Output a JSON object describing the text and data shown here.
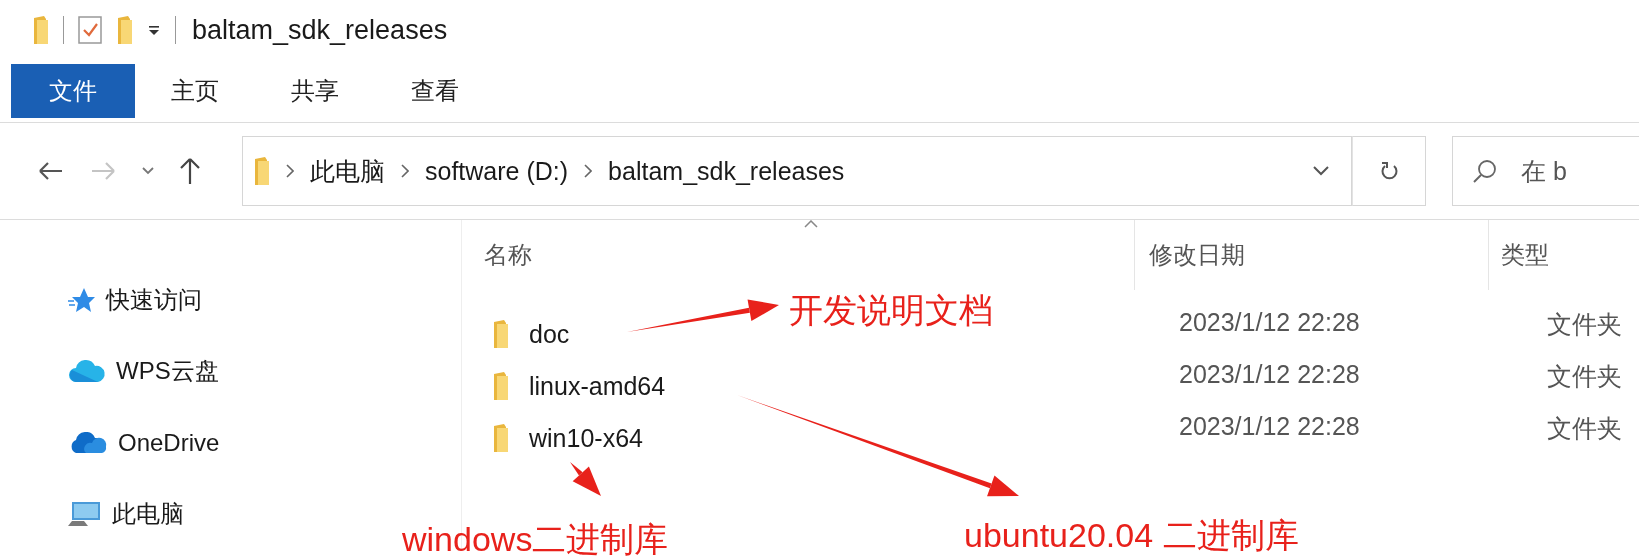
{
  "title_bar": {
    "title": "baltam_sdk_releases"
  },
  "ribbon": {
    "tabs": [
      {
        "label": "文件",
        "selected": true
      },
      {
        "label": "主页",
        "selected": false
      },
      {
        "label": "共享",
        "selected": false
      },
      {
        "label": "查看",
        "selected": false
      }
    ]
  },
  "address_bar": {
    "crumbs": [
      "此电脑",
      "software (D:)",
      "baltam_sdk_releases"
    ]
  },
  "search": {
    "placeholder": "在 b"
  },
  "sidebar": {
    "items": [
      {
        "label": "快速访问",
        "kind": "star"
      },
      {
        "label": "WPS云盘",
        "kind": "cloud"
      },
      {
        "label": "OneDrive",
        "kind": "onedrive"
      },
      {
        "label": "此电脑",
        "kind": "pc"
      }
    ]
  },
  "file_list": {
    "columns": [
      {
        "label": "名称",
        "sorted": true
      },
      {
        "label": "修改日期",
        "sorted": false
      },
      {
        "label": "类型",
        "sorted": false
      }
    ],
    "rows": [
      {
        "name": "doc",
        "modified": "2023/1/12 22:28",
        "type": "文件夹"
      },
      {
        "name": "linux-amd64",
        "modified": "2023/1/12 22:28",
        "type": "文件夹"
      },
      {
        "name": "win10-x64",
        "modified": "2023/1/12 22:28",
        "type": "文件夹"
      }
    ]
  },
  "annotations": [
    {
      "text": "开发说明文档"
    },
    {
      "text": "windows二进制库"
    },
    {
      "text": "ubuntu20.04 二进制库"
    }
  ]
}
